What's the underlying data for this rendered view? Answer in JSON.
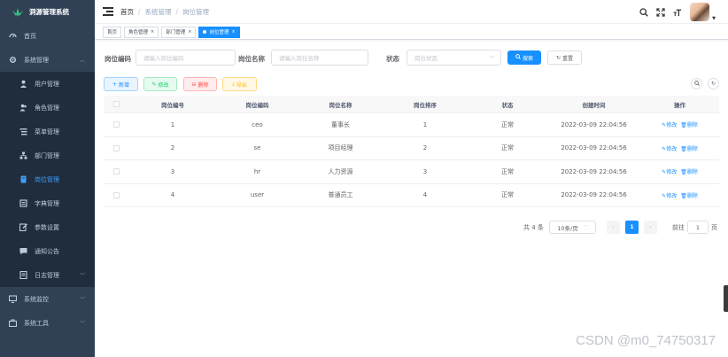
{
  "app": {
    "title": "洞源管理系统"
  },
  "sidebar": {
    "home": "首页",
    "system": "系统管理",
    "items": [
      {
        "label": "用户管理",
        "icon": "user-icon"
      },
      {
        "label": "角色管理",
        "icon": "peoples-icon"
      },
      {
        "label": "菜单管理",
        "icon": "tree-table-icon"
      },
      {
        "label": "部门管理",
        "icon": "tree-icon"
      },
      {
        "label": "岗位管理",
        "icon": "post-icon"
      },
      {
        "label": "字典管理",
        "icon": "dict-icon"
      },
      {
        "label": "参数设置",
        "icon": "edit-icon"
      },
      {
        "label": "通知公告",
        "icon": "message-icon"
      },
      {
        "label": "日志管理",
        "icon": "log-icon"
      }
    ],
    "monitor": "系统监控",
    "tool": "系统工具"
  },
  "breadcrumb": [
    "首页",
    "系统管理",
    "岗位管理"
  ],
  "tags": [
    {
      "label": "首页"
    },
    {
      "label": "角色管理"
    },
    {
      "label": "部门管理"
    },
    {
      "label": "岗位管理"
    }
  ],
  "search": {
    "code_label": "岗位编码",
    "code_placeholder": "请输入岗位编码",
    "name_label": "岗位名称",
    "name_placeholder": "请输入岗位名称",
    "status_label": "状态",
    "status_placeholder": "岗位状态",
    "search_btn": "搜索",
    "reset_btn": "重置"
  },
  "toolbar": {
    "add": "新增",
    "edit": "修改",
    "delete": "删除",
    "export": "导出"
  },
  "table": {
    "headers": [
      "岗位编号",
      "岗位编码",
      "岗位名称",
      "岗位排序",
      "状态",
      "创建时间",
      "操作"
    ],
    "rows": [
      {
        "id": "1",
        "code": "ceo",
        "name": "董事长",
        "sort": "1",
        "status": "正常",
        "time": "2022-03-09 22:04:56"
      },
      {
        "id": "2",
        "code": "se",
        "name": "项目经理",
        "sort": "2",
        "status": "正常",
        "time": "2022-03-09 22:04:56"
      },
      {
        "id": "3",
        "code": "hr",
        "name": "人力资源",
        "sort": "3",
        "status": "正常",
        "time": "2022-03-09 22:04:56"
      },
      {
        "id": "4",
        "code": "user",
        "name": "普通员工",
        "sort": "4",
        "status": "正常",
        "time": "2022-03-09 22:04:56"
      }
    ],
    "op_edit": "修改",
    "op_delete": "删除"
  },
  "pagination": {
    "total": "共 4 条",
    "page_size": "10条/页",
    "current": "1",
    "goto_label": "前往",
    "goto_value": "1",
    "page_unit": "页"
  },
  "watermark": "CSDN @m0_74750317",
  "colors": {
    "sidebar_bg": "#304156",
    "primary": "#1890ff"
  }
}
